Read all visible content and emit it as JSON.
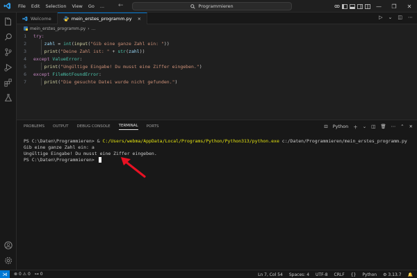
{
  "titlebar": {
    "menu": [
      "File",
      "Edit",
      "Selection",
      "View",
      "Go",
      "..."
    ],
    "search_text": "Programmieren"
  },
  "tabs": [
    {
      "label": "Welcome",
      "active": false
    },
    {
      "label": "mein_erstes_programm.py",
      "active": true,
      "close": "×"
    }
  ],
  "breadcrumb": {
    "file": "mein_erstes_programm.py",
    "more": "..."
  },
  "code": [
    {
      "n": "1",
      "parts": [
        [
          "kw",
          "try:"
        ]
      ]
    },
    {
      "n": "2",
      "parts": [
        [
          "pl",
          "    "
        ],
        [
          "vr",
          "zahl"
        ],
        [
          "pl",
          " = "
        ],
        [
          "cls",
          "int"
        ],
        [
          "pl",
          "("
        ],
        [
          "fn",
          "input"
        ],
        [
          "pl",
          "("
        ],
        [
          "str",
          "\"Gib eine ganze Zahl ein: \""
        ],
        [
          "pl",
          "))"
        ]
      ]
    },
    {
      "n": "3",
      "parts": [
        [
          "pl",
          "    "
        ],
        [
          "fn",
          "print"
        ],
        [
          "pl",
          "("
        ],
        [
          "str",
          "\"Deine Zahl ist: \""
        ],
        [
          "pl",
          " + "
        ],
        [
          "cls",
          "str"
        ],
        [
          "pl",
          "("
        ],
        [
          "vr",
          "zahl"
        ],
        [
          "pl",
          "))"
        ]
      ]
    },
    {
      "n": "4",
      "parts": [
        [
          "kw",
          "except "
        ],
        [
          "cls",
          "ValueError"
        ],
        [
          "pl",
          ":"
        ]
      ]
    },
    {
      "n": "5",
      "parts": [
        [
          "pl",
          "    "
        ],
        [
          "fn",
          "print"
        ],
        [
          "pl",
          "("
        ],
        [
          "str",
          "\"Ungültige Eingabe! Du musst eine Ziffer eingeben.\""
        ],
        [
          "pl",
          ")"
        ]
      ]
    },
    {
      "n": "6",
      "parts": [
        [
          "kw",
          "except "
        ],
        [
          "cls",
          "FileNotFoundError"
        ],
        [
          "pl",
          ":"
        ]
      ]
    },
    {
      "n": "7",
      "parts": [
        [
          "pl",
          "    "
        ],
        [
          "fn",
          "print"
        ],
        [
          "pl",
          "("
        ],
        [
          "str",
          "\"Die gesuchte Datei wurde nicht gefunden.\""
        ],
        [
          "pl",
          ")"
        ]
      ]
    }
  ],
  "panel": {
    "tabs": [
      "PROBLEMS",
      "OUTPUT",
      "DEBUG CONSOLE",
      "TERMINAL",
      "PORTS"
    ],
    "active_tab": "TERMINAL",
    "terminal_name": "Python",
    "lines": [
      {
        "a": "PS C:\\Daten\\Programmieren> & ",
        "b": "C:/Users/webma/AppData/Local/Programs/Python/Python313/python.exe",
        "c": " c:/Daten/Programmieren/mein_erstes_programm.py"
      },
      {
        "a": "Gib eine ganze Zahl ein: a",
        "b": "",
        "c": ""
      },
      {
        "a": "Ungültige Eingabe! Du musst eine Ziffer eingeben.",
        "b": "",
        "c": ""
      },
      {
        "a": "PS C:\\Daten\\Programmieren> ",
        "b": "",
        "c": "",
        "cursor": true
      }
    ]
  },
  "statusbar": {
    "errors": "0",
    "warnings": "0",
    "ports": "0",
    "position": "Ln 7, Col 54",
    "spaces": "Spaces: 4",
    "encoding": "UTF-8",
    "eol": "CRLF",
    "braces": "{}",
    "language": "Python",
    "version": "3.13.7"
  },
  "colors": {
    "accent": "#0078d4",
    "arrow": "#e81123"
  }
}
